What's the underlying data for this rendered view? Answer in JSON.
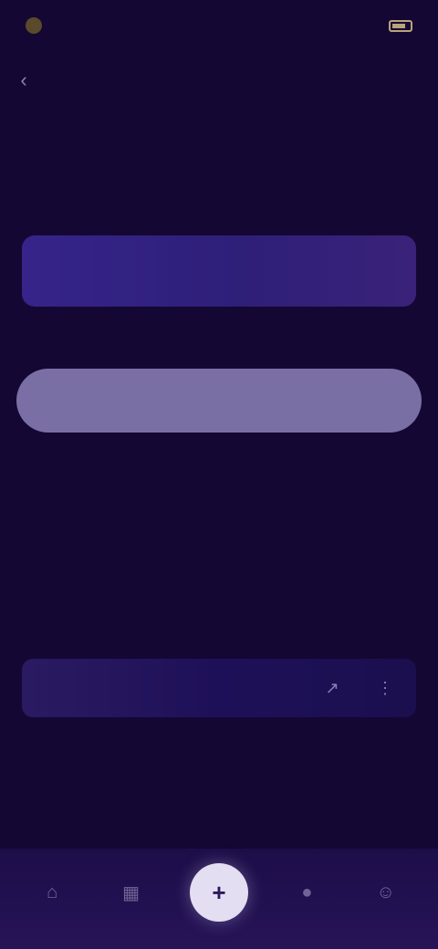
{
  "status_bar": {
    "time": "",
    "battery_icon": "battery-icon"
  },
  "top_bar": {
    "title": "",
    "back_icon": "chevron-left-icon"
  },
  "page": {
    "title": ""
  },
  "banner": {
    "text": ""
  },
  "primary_button": {
    "label": ""
  },
  "section": {
    "label": ""
  },
  "option_row": {
    "text": "",
    "icons": [
      "share-icon",
      "more-icon"
    ]
  },
  "bottom_nav": {
    "items": [
      {
        "icon": "home-icon"
      },
      {
        "icon": "grid-icon"
      },
      {
        "icon": "add-icon"
      },
      {
        "icon": "chat-icon"
      },
      {
        "icon": "profile-icon"
      }
    ]
  },
  "colors": {
    "background": "#150733",
    "banner": "#36248a",
    "button": "#7a6fa5",
    "nav_center": "#e4def2"
  }
}
